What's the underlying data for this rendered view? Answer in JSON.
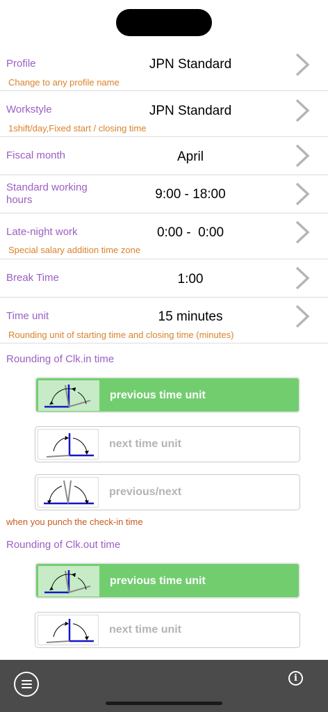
{
  "rows": [
    {
      "label": "Profile",
      "value": "JPN Standard",
      "sub": "Change to any profile name"
    },
    {
      "label": "Workstyle",
      "value": "JPN Standard",
      "sub": "1shift/day,Fixed start / closing time"
    },
    {
      "label": "Fiscal month",
      "value": "April",
      "sub": ""
    },
    {
      "label": "Standard working hours",
      "value": "9:00 - 18:00",
      "sub": ""
    },
    {
      "label": "Late-night work",
      "value": "0:00 -  0:00",
      "sub": "Special salary addition time zone"
    },
    {
      "label": "Break Time",
      "value": "1:00",
      "sub": ""
    },
    {
      "label": "Time unit",
      "value": "15 minutes",
      "sub": "Rounding unit of starting time and closing time (minutes)"
    }
  ],
  "clock_in": {
    "title": "Rounding of Clk.in time",
    "options": [
      "previous time unit",
      "next time unit",
      "previous/next"
    ],
    "selected": "previous time unit",
    "note": "when you punch the check-in time"
  },
  "clock_out": {
    "title": "Rounding of Clk.out time",
    "options": [
      "previous time unit",
      "next time unit"
    ],
    "selected": "previous time unit"
  },
  "icons": {
    "chevron": "chevron-right-icon",
    "menu": "menu-icon",
    "info": "info-icon"
  },
  "colors": {
    "label": "#9a5fc4",
    "subtext": "#d9822b",
    "selected_green": "#72cd6f",
    "bottom_bar": "#4b4b4b"
  }
}
